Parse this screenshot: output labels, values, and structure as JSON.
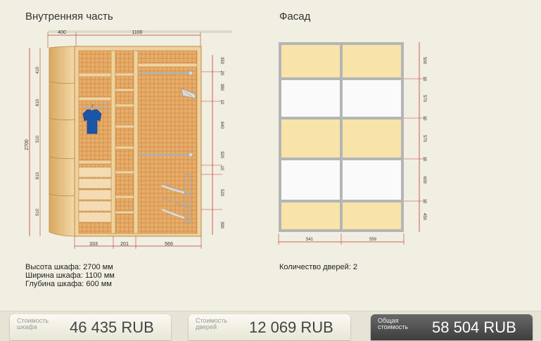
{
  "interior": {
    "title": "Внутренняя часть",
    "dims_top": [
      "400",
      "1100"
    ],
    "dims_bottom": [
      "333",
      "201",
      "566"
    ],
    "dims_left": [
      "410",
      "610",
      "510",
      "610",
      "510"
    ],
    "height_total": "2700",
    "dims_right": [
      "350",
      "20",
      "380",
      "10",
      "640",
      "320",
      "10",
      "520",
      "390"
    ]
  },
  "facade": {
    "title": "Фасад",
    "dims_bottom": [
      "541",
      "559"
    ],
    "dims_right": [
      "500",
      "10",
      "570",
      "10",
      "570",
      "10",
      "600",
      "10",
      "450"
    ]
  },
  "specs": {
    "height": "Высота шкафа: 2700 мм",
    "width": "Ширина шкафа: 1100 мм",
    "depth": "Глубина шкафа: 600 мм"
  },
  "doors_count": "Количество дверей: 2",
  "prices": {
    "cabinet": {
      "label_line1": "Стоимость",
      "label_line2": "шкафа",
      "value": "46 435  RUB"
    },
    "doors": {
      "label_line1": "Стоимость",
      "label_line2": "дверей",
      "value": "12 069  RUB"
    },
    "total": {
      "label_line1": "Общая",
      "label_line2": "стоимость",
      "value": "58 504  RUB"
    }
  },
  "colors": {
    "background": "#f0efe2",
    "wood": "#e9c48a",
    "wood_frame": "#d9a860",
    "dimension_line": "#c0392b",
    "facade_yellow": "#f8e4a8",
    "facade_white": "#fafafa",
    "facade_frame": "#aaaaaa",
    "total_box": "#4a4a4a"
  },
  "icons": [
    "shirt-icon",
    "hanger-rail-icon",
    "shoe-rack-icon",
    "tie-rack-icon"
  ]
}
